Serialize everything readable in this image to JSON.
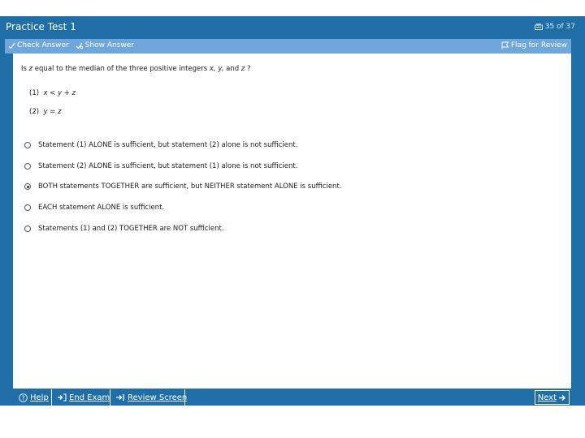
{
  "window": {
    "title": "Practice Test 1",
    "counter": "35 of 37"
  },
  "toolbar": {
    "check_answer": "Check Answer",
    "show_answer": "Show Answer",
    "flag_review": "Flag for Review"
  },
  "question": {
    "prefix": "Is ",
    "var_z": "z",
    "middle": " equal to the median of the three positive integers ",
    "vars_list": "x, y,",
    "and": " and ",
    "var_z2": "z",
    "suffix": " ?",
    "statements": [
      {
        "num": "(1)",
        "expr": "x < y + z"
      },
      {
        "num": "(2)",
        "expr": "y = z"
      }
    ]
  },
  "choices": [
    {
      "label": "Statement (1) ALONE is sufficient, but statement (2) alone is not sufficient.",
      "selected": false
    },
    {
      "label": "Statement (2) ALONE is sufficient, but statement (1) alone is not sufficient.",
      "selected": false
    },
    {
      "label": "BOTH statements TOGETHER are sufficient, but NEITHER statement ALONE is sufficient.",
      "selected": true
    },
    {
      "label": "EACH statement ALONE is sufficient.",
      "selected": false
    },
    {
      "label": "Statements (1) and (2) TOGETHER are NOT sufficient.",
      "selected": false
    }
  ],
  "footer": {
    "help": "Help",
    "end_exam": "End Exam",
    "review_screen": "Review Screen",
    "next": "Next"
  },
  "colors": {
    "frame": "#1f6ea8",
    "toolbar": "#6fa6dc",
    "content": "#ffffff"
  }
}
